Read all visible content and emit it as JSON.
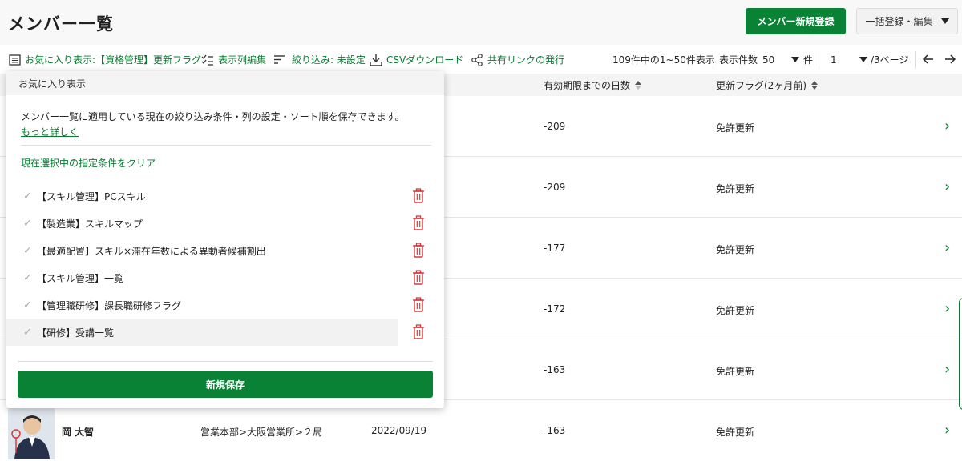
{
  "header": {
    "title": "メンバー一覧",
    "new_member_label": "メンバー新規登録",
    "bulk_label": "一括登録・編集"
  },
  "toolbar": {
    "favorite_label": "お気に入り表示:【資格管理】更新フラグ",
    "columns_label": "表示列編集",
    "filter_label": "絞り込み: 未設定",
    "csv_label": "CSVダウンロード",
    "share_label": "共有リンクの発行",
    "range_text": "109件中の1~50件表示",
    "per_page_label": "表示件数",
    "per_page_value": "50",
    "per_page_unit": "件",
    "page_value": "1",
    "page_total": "/3ページ"
  },
  "table": {
    "col_days": "有効期限までの日数",
    "col_flag": "更新フラグ(2ヶ月前)",
    "rows": [
      {
        "days": "-209",
        "flag": "免許更新"
      },
      {
        "days": "-209",
        "flag": "免許更新"
      },
      {
        "days": "-177",
        "flag": "免許更新"
      },
      {
        "days": "-172",
        "flag": "免許更新"
      },
      {
        "days": "-163",
        "flag": "免許更新"
      },
      {
        "name": "岡 大智",
        "dept": "営業本部>大阪営業所>２局",
        "date": "2022/09/19",
        "days": "-163",
        "flag": "免許更新"
      }
    ]
  },
  "favorites_panel": {
    "title": "お気に入り表示",
    "description": "メンバー一覧に適用している現在の絞り込み条件・列の設定・ソート順を保存できます。",
    "more_link": "もっと詳しく",
    "clear_link": "現在選択中の指定条件をクリア",
    "items": [
      {
        "label": "【スキル管理】PCスキル"
      },
      {
        "label": "【製造業】スキルマップ"
      },
      {
        "label": "【最適配置】スキル×滞在年数による異動者候補割出"
      },
      {
        "label": "【スキル管理】一覧"
      },
      {
        "label": "【管理職研修】課長職研修フラグ"
      },
      {
        "label": "【研修】受講一覧"
      }
    ],
    "save_label": "新規保存"
  },
  "colors": {
    "accent": "#0a8235",
    "danger": "#d9383a"
  },
  "icons": [
    "list-icon",
    "columns-icon",
    "filter-icon",
    "download-icon",
    "share-icon",
    "check-icon",
    "trash-icon",
    "chevron-right-icon",
    "arrow-left-icon",
    "arrow-right-icon",
    "caret-down-icon"
  ]
}
